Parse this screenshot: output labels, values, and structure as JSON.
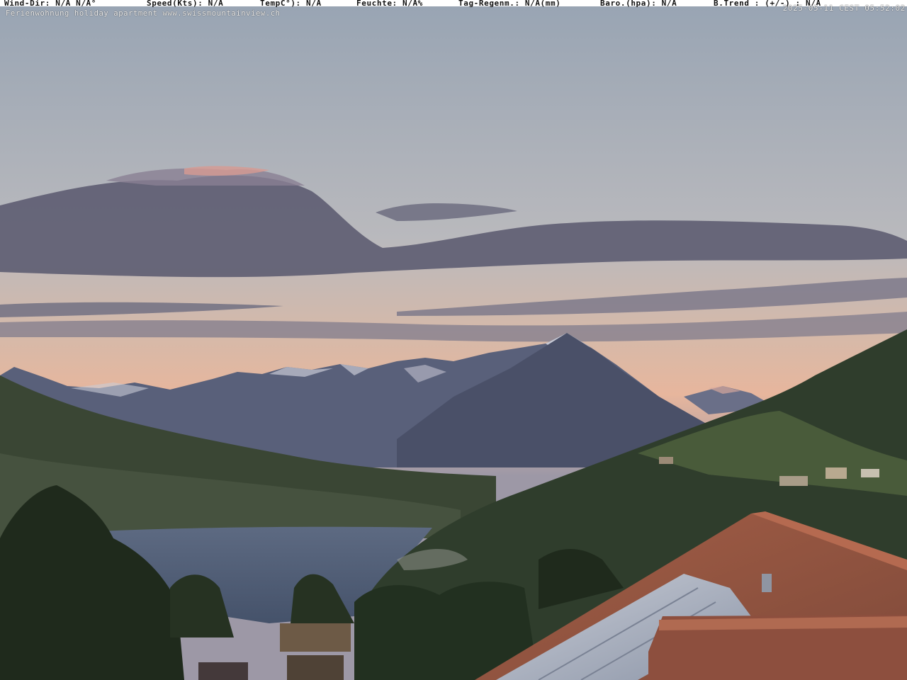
{
  "weather_bar": {
    "wind_dir": "Wind-Dir: N/A  N/A°",
    "speed": "Speed(Kts):   N/A",
    "temp": "TempC°):   N/A",
    "humidity": "Feuchte:  N/A%",
    "rain": "Tag-Regenm.:   N/A(mm)",
    "baro": "Baro.(hpa):   N/A",
    "trend": "B.Trend  : (+/-) : N/A"
  },
  "timestamp": "2025-05-11 CEST 05:52:02",
  "caption": "Ferienwohnung holiday apartment www.swissmountainview.ch",
  "colors": {
    "sky_top": "#9aa6b4",
    "sky_glow": "#e8b8a0",
    "cloud": "#5e5d72",
    "mountain": "#4c5368",
    "lake": "#53617a",
    "forest": "#2a3526",
    "roof": "#9a5a44"
  }
}
